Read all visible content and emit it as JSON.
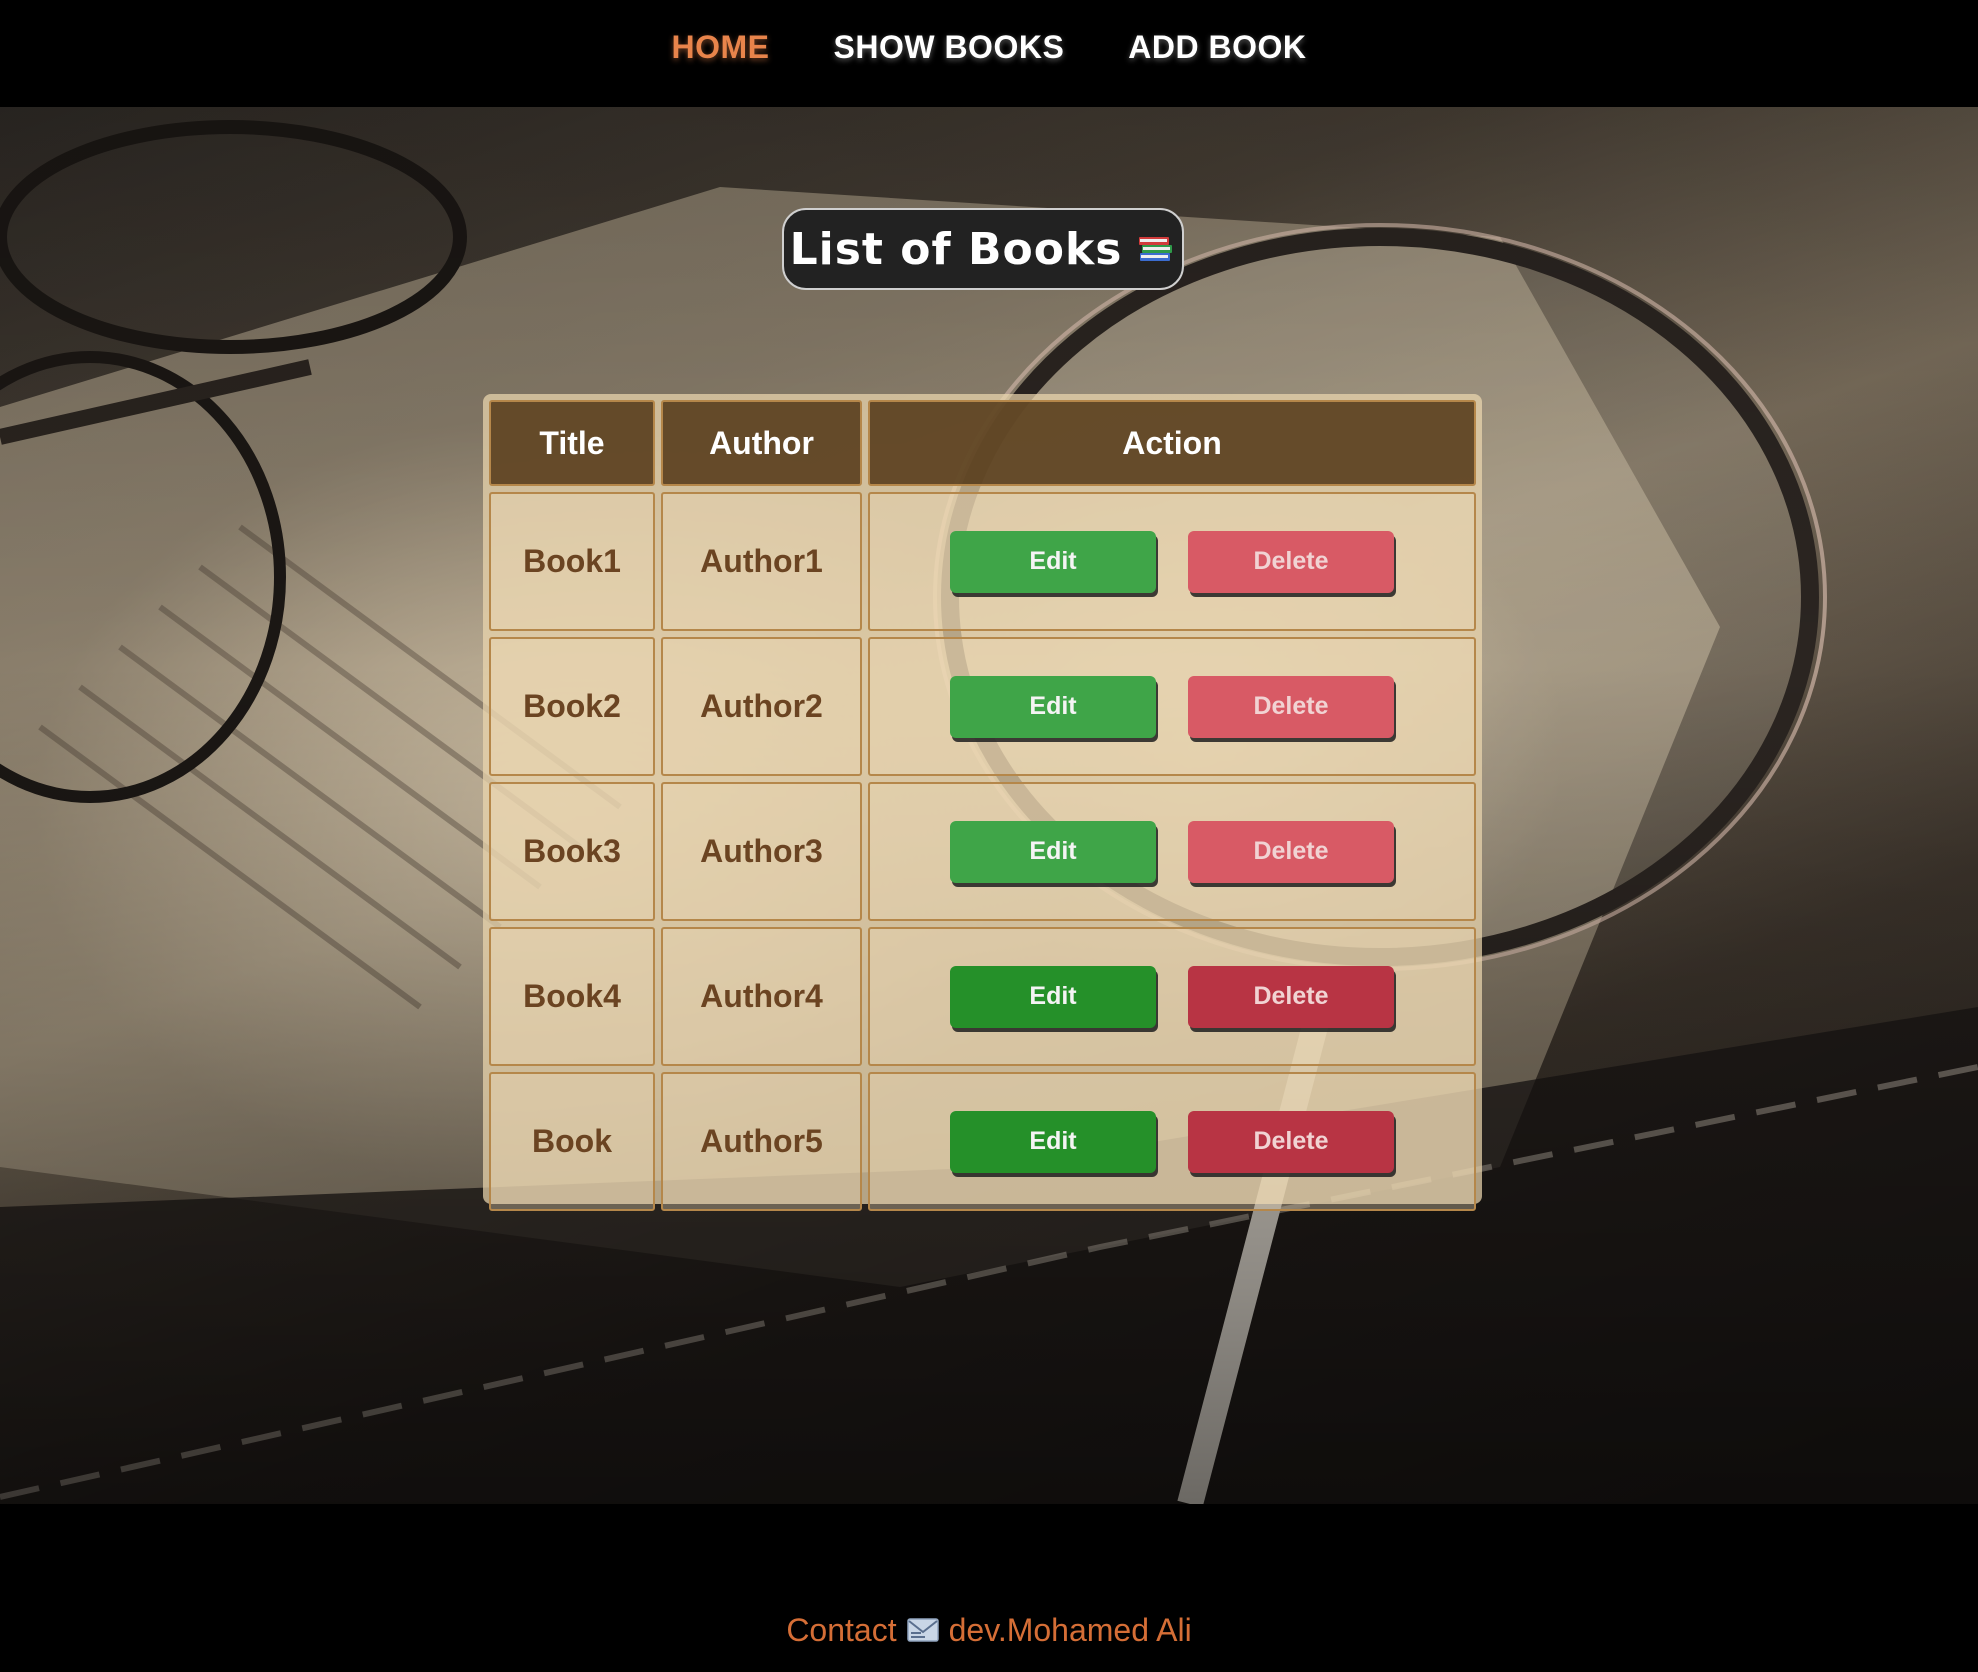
{
  "nav": {
    "items": [
      {
        "label": "HOME",
        "active": true
      },
      {
        "label": "SHOW BOOKS",
        "active": false
      },
      {
        "label": "ADD BOOK",
        "active": false
      }
    ]
  },
  "heading": {
    "title": "List of Books",
    "icon": "books-icon"
  },
  "table": {
    "headers": {
      "title": "Title",
      "author": "Author",
      "action": "Action"
    },
    "rows": [
      {
        "title": "Book1",
        "author": "Author1",
        "edit": "Edit",
        "delete": "Delete"
      },
      {
        "title": "Book2",
        "author": "Author2",
        "edit": "Edit",
        "delete": "Delete"
      },
      {
        "title": "Book3",
        "author": "Author3",
        "edit": "Edit",
        "delete": "Delete"
      },
      {
        "title": "Book4",
        "author": "Author4",
        "edit": "Edit",
        "delete": "Delete"
      },
      {
        "title": "Book",
        "author": "Author5",
        "edit": "Edit",
        "delete": "Delete"
      }
    ]
  },
  "footer": {
    "contact_label": "Contact",
    "icon": "mail-icon",
    "name": "dev.Mohamed Ali"
  },
  "colors": {
    "nav_active": "#e8844b",
    "edit_button": "#3fa548",
    "delete_button": "#d85a65",
    "footer_text": "#d56e36"
  }
}
